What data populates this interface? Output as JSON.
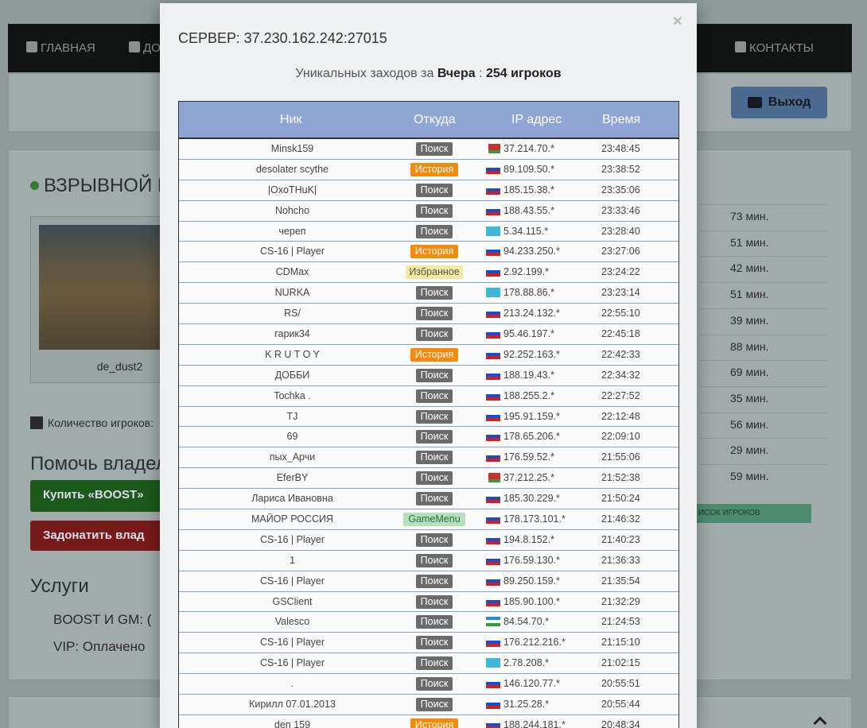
{
  "nav": {
    "items": [
      {
        "label": "ГЛАВНАЯ"
      },
      {
        "label": "ДО"
      },
      {
        "label": "КОНТАКТЫ"
      }
    ]
  },
  "header": {
    "logout_label": "Выход"
  },
  "server": {
    "name": "ВЗРЫВНОЙ D",
    "map": "de_dust2",
    "players_label": "Количество игроков:"
  },
  "help": {
    "title": "Помочь владел",
    "boost_label": "Купить «BOOST»",
    "donate_label": "Задонатить влад"
  },
  "services": {
    "title": "Услуги",
    "boost_gm": "BOOST И GM:   (",
    "vip": "VIP:   Оплачено"
  },
  "right_minutes": [
    "73 мин.",
    "51 мин.",
    "42 мин.",
    "51 мин.",
    "39 мин.",
    "88 мин.",
    "69 мин.",
    "35 мин.",
    "56 мин.",
    "29 мин.",
    "59 мин."
  ],
  "players_list_button": "ИСОК ИГРОКОВ",
  "modal": {
    "close": "×",
    "title": "СЕРВЕР: 37.230.162.242:27015",
    "subtitle_prefix": "Уникальных заходов за",
    "subtitle_period": "Вчера",
    "subtitle_sep": ":",
    "subtitle_count": "254 игроков",
    "columns": {
      "nick": "Ник",
      "source": "Откуда",
      "ip": "IP адрес",
      "time": "Время"
    },
    "rows": [
      {
        "nick": "Minsk159",
        "source": "Поиск",
        "type": "search",
        "flag": "by",
        "ip": "37.214.70.*",
        "time": "23:48:45"
      },
      {
        "nick": "desolater scythe",
        "source": "История",
        "type": "history",
        "flag": "ru",
        "ip": "89.109.50.*",
        "time": "23:38:52"
      },
      {
        "nick": "|OxoTHuK|",
        "source": "Поиск",
        "type": "search",
        "flag": "ru",
        "ip": "185.15.38.*",
        "time": "23:35:06"
      },
      {
        "nick": "Nohcho",
        "source": "Поиск",
        "type": "search",
        "flag": "ru",
        "ip": "188.43.55.*",
        "time": "23:33:46"
      },
      {
        "nick": "череп",
        "source": "Поиск",
        "type": "search",
        "flag": "kz",
        "ip": "5.34.115.*",
        "time": "23:28:40"
      },
      {
        "nick": "CS-16 | Player",
        "source": "История",
        "type": "history",
        "flag": "ru",
        "ip": "94.233.250.*",
        "time": "23:27:06"
      },
      {
        "nick": "CDMax",
        "source": "Избранное",
        "type": "fav",
        "flag": "ru",
        "ip": "2.92.199.*",
        "time": "23:24:22"
      },
      {
        "nick": "NURKA",
        "source": "Поиск",
        "type": "search",
        "flag": "kz",
        "ip": "178.88.86.*",
        "time": "23:23:14"
      },
      {
        "nick": "RS/",
        "source": "Поиск",
        "type": "search",
        "flag": "ru",
        "ip": "213.24.132.*",
        "time": "22:55:10"
      },
      {
        "nick": "гарик34",
        "source": "Поиск",
        "type": "search",
        "flag": "ru",
        "ip": "95.46.197.*",
        "time": "22:45:18"
      },
      {
        "nick": "K R U T O Y",
        "source": "История",
        "type": "history",
        "flag": "ru",
        "ip": "92.252.163.*",
        "time": "22:42:33"
      },
      {
        "nick": "ДОББИ",
        "source": "Поиск",
        "type": "search",
        "flag": "ru",
        "ip": "188.19.43.*",
        "time": "22:34:32"
      },
      {
        "nick": "Tochka .",
        "source": "Поиск",
        "type": "search",
        "flag": "ru",
        "ip": "188.255.2.*",
        "time": "22:27:52"
      },
      {
        "nick": "TJ",
        "source": "Поиск",
        "type": "search",
        "flag": "ru",
        "ip": "195.91.159.*",
        "time": "22:12:48"
      },
      {
        "nick": "69",
        "source": "Поиск",
        "type": "search",
        "flag": "ru",
        "ip": "178.65.206.*",
        "time": "22:09:10"
      },
      {
        "nick": "пых_Арчи",
        "source": "Поиск",
        "type": "search",
        "flag": "ru",
        "ip": "176.59.52.*",
        "time": "21:55:06"
      },
      {
        "nick": "EferBY",
        "source": "Поиск",
        "type": "search",
        "flag": "by",
        "ip": "37.212.25.*",
        "time": "21:52:38"
      },
      {
        "nick": "Лариса Ивановна",
        "source": "Поиск",
        "type": "search",
        "flag": "ru",
        "ip": "185.30.229.*",
        "time": "21:50:24"
      },
      {
        "nick": "МАЙОР РОССИЯ",
        "source": "GameMenu",
        "type": "gm",
        "flag": "ru",
        "ip": "178.173.101.*",
        "time": "21:46:32"
      },
      {
        "nick": "CS-16 | Player",
        "source": "Поиск",
        "type": "search",
        "flag": "ru",
        "ip": "194.8.152.*",
        "time": "21:40:23"
      },
      {
        "nick": "1",
        "source": "Поиск",
        "type": "search",
        "flag": "ru",
        "ip": "176.59.130.*",
        "time": "21:36:33"
      },
      {
        "nick": "CS-16 | Player",
        "source": "Поиск",
        "type": "search",
        "flag": "ru",
        "ip": "89.250.159.*",
        "time": "21:35:54"
      },
      {
        "nick": "GSClient",
        "source": "Поиск",
        "type": "search",
        "flag": "ru",
        "ip": "185.90.100.*",
        "time": "21:32:29"
      },
      {
        "nick": "Valesco",
        "source": "Поиск",
        "type": "search",
        "flag": "uz",
        "ip": "84.54.70.*",
        "time": "21:24:53"
      },
      {
        "nick": "CS-16 | Player",
        "source": "Поиск",
        "type": "search",
        "flag": "ru",
        "ip": "176.212.216.*",
        "time": "21:15:10"
      },
      {
        "nick": "CS-16 | Player",
        "source": "Поиск",
        "type": "search",
        "flag": "kz",
        "ip": "2.78.208.*",
        "time": "21:02:15"
      },
      {
        "nick": ".",
        "source": "Поиск",
        "type": "search",
        "flag": "ru",
        "ip": "146.120.77.*",
        "time": "20:55:51"
      },
      {
        "nick": "Кирилл 07.01.2013",
        "source": "Поиск",
        "type": "search",
        "flag": "ru",
        "ip": "31.25.28.*",
        "time": "20:55:44"
      },
      {
        "nick": "den 159",
        "source": "История",
        "type": "history",
        "flag": "ru",
        "ip": "188.244.181.*",
        "time": "20:48:34"
      }
    ]
  }
}
